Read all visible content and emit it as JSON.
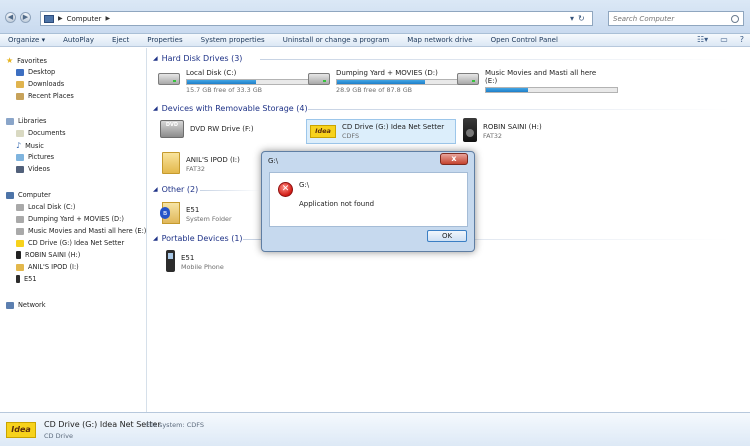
{
  "address": {
    "path": "Computer",
    "search_placeholder": "Search Computer"
  },
  "toolbar": {
    "items": [
      "Organize ▾",
      "AutoPlay",
      "Eject",
      "Properties",
      "System properties",
      "Uninstall or change a program",
      "Map network drive",
      "Open Control Panel"
    ]
  },
  "sidebar": {
    "favorites": "Favorites",
    "fav_items": [
      "Desktop",
      "Downloads",
      "Recent Places"
    ],
    "libraries": "Libraries",
    "lib_items": [
      "Documents",
      "Music",
      "Pictures",
      "Videos"
    ],
    "computer": "Computer",
    "comp_items": [
      "Local Disk (C:)",
      "Dumping Yard + MOVIES (D:)",
      "Music Movies and Masti all here  (E:)",
      "CD Drive (G:) Idea Net Setter",
      "ROBIN SAINI (H:)",
      "ANIL'S IPOD (I:)",
      "E51"
    ],
    "network": "Network"
  },
  "groups": {
    "hdd": "Hard Disk Drives (3)",
    "removable": "Devices with Removable Storage (4)",
    "other": "Other (2)",
    "portable": "Portable Devices (1)"
  },
  "drives": [
    {
      "name": "Local Disk (C:)",
      "sub": "15.7 GB free of 33.3 GB",
      "used": 0.53
    },
    {
      "name": "Dumping Yard + MOVIES (D:)",
      "sub": "28.9 GB free of 87.8 GB",
      "used": 0.67
    },
    {
      "name": "Music Movies and Masti all here",
      "name2": "(E:)",
      "used": 0.32
    }
  ],
  "removable": [
    {
      "name": "DVD RW Drive (F:)"
    },
    {
      "name": "CD Drive (G:) Idea Net Setter",
      "sub": "CDFS"
    },
    {
      "name": "ROBIN SAINI (H:)",
      "sub": "FAT32"
    },
    {
      "name": "ANIL'S IPOD (I:)",
      "sub": "FAT32"
    }
  ],
  "other": [
    {
      "name": "E51",
      "sub": "System Folder"
    }
  ],
  "portable": [
    {
      "name": "E51",
      "sub": "Mobile Phone"
    }
  ],
  "dialog": {
    "title": "G:\\",
    "path": "G:\\",
    "message": "Application not found",
    "ok": "OK",
    "close": "x"
  },
  "details": {
    "name": "CD Drive (G:) Idea Net Setter",
    "fs": "File system: CDFS",
    "type": "CD Drive",
    "icon_text": "Idea"
  },
  "icons": {
    "idea_text": "Idea",
    "dvd_text": "DVD"
  }
}
